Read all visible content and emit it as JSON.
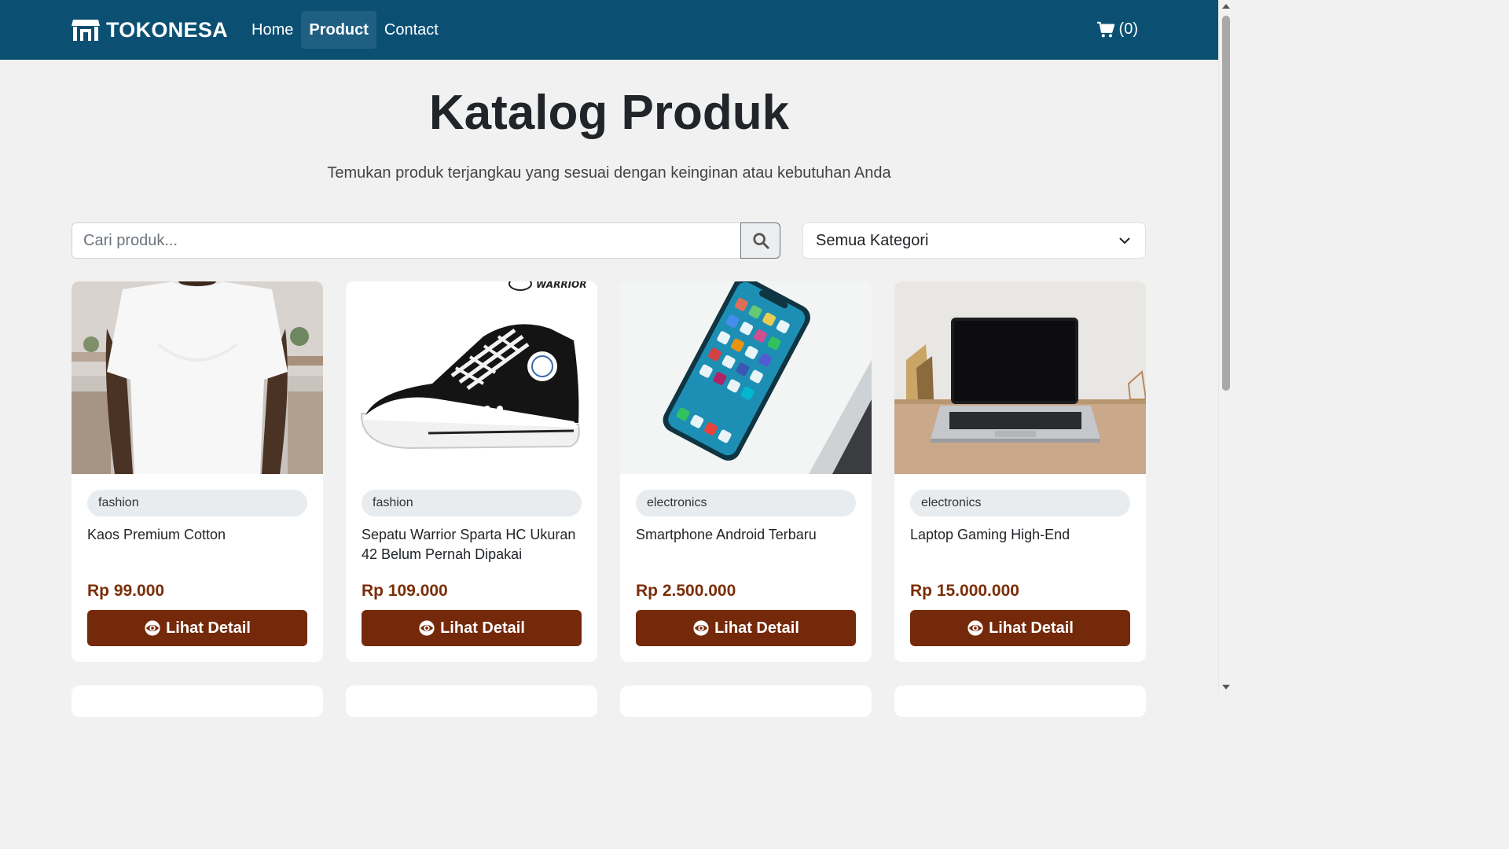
{
  "navbar": {
    "brand": "TOKONESA",
    "links": [
      {
        "label": "Home",
        "active": false
      },
      {
        "label": "Product",
        "active": true
      },
      {
        "label": "Contact",
        "active": false
      }
    ],
    "cart_count": "(0)"
  },
  "header": {
    "title": "Katalog Produk",
    "subtitle": "Temukan produk terjangkau yang sesuai dengan keinginan atau kebutuhan Anda"
  },
  "search": {
    "placeholder": "Cari produk...",
    "value": ""
  },
  "category_filter": {
    "selected": "Semua Kategori"
  },
  "products": [
    {
      "category": "fashion",
      "name": "Kaos Premium Cotton",
      "price": "Rp 99.000",
      "button": "Lihat Detail",
      "image": "white-tshirt"
    },
    {
      "category": "fashion",
      "name": "Sepatu Warrior Sparta HC Ukuran 42 Belum Pernah Dipakai",
      "price": "Rp 109.000",
      "button": "Lihat Detail",
      "image": "black-hightop-sneaker"
    },
    {
      "category": "electronics",
      "name": "Smartphone Android Terbaru",
      "price": "Rp 2.500.000",
      "button": "Lihat Detail",
      "image": "smartphone"
    },
    {
      "category": "electronics",
      "name": "Laptop Gaming High-End",
      "price": "Rp 15.000.000",
      "button": "Lihat Detail",
      "image": "laptop-on-desk"
    }
  ],
  "colors": {
    "navbar": "#0b5073",
    "button": "#74290b",
    "price": "#7a2e08",
    "background": "#f1f1f1"
  },
  "icons": [
    "store-icon",
    "cart-icon",
    "search-icon",
    "chevron-down-icon",
    "eye-icon"
  ]
}
